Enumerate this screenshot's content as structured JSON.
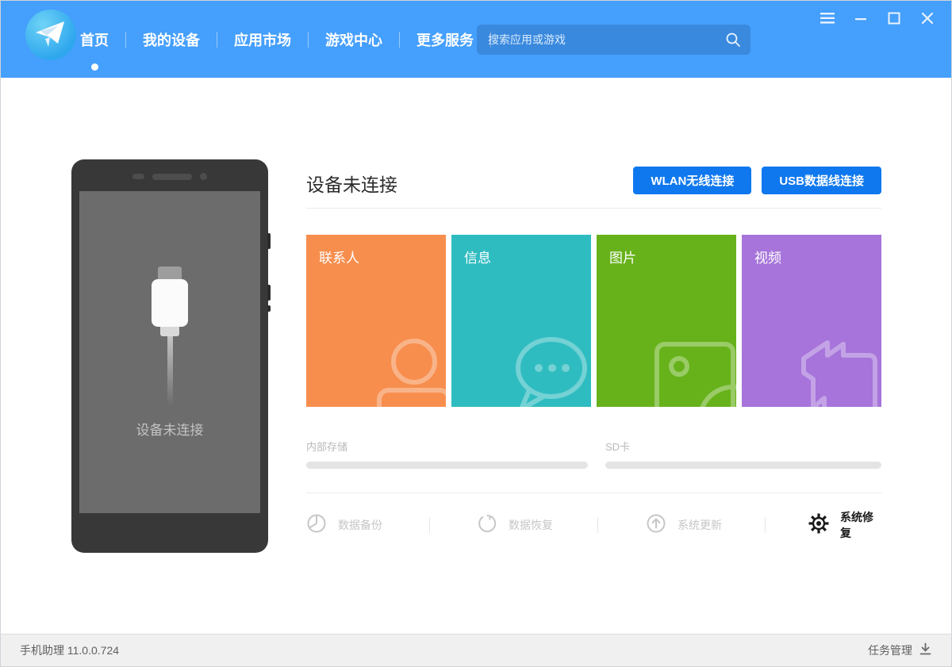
{
  "header": {
    "nav": [
      {
        "label": "首页",
        "active": true
      },
      {
        "label": "我的设备",
        "active": false
      },
      {
        "label": "应用市场",
        "active": false
      },
      {
        "label": "游戏中心",
        "active": false
      },
      {
        "label": "更多服务",
        "active": false
      }
    ],
    "search_placeholder": "搜索应用或游戏",
    "colors": {
      "header_blue": "#459ffc",
      "button_blue": "#0f78ee"
    }
  },
  "device": {
    "status_title": "设备未连接",
    "phone_overlay_text": "设备未连接",
    "connect_buttons": [
      {
        "label": "WLAN无线连接"
      },
      {
        "label": "USB数据线连接"
      }
    ]
  },
  "tiles": [
    {
      "label": "联系人",
      "color": "#f78e4e",
      "icon": "contacts-icon"
    },
    {
      "label": "信息",
      "color": "#2fbcc0",
      "icon": "messages-icon"
    },
    {
      "label": "图片",
      "color": "#67b21b",
      "icon": "pictures-icon"
    },
    {
      "label": "视频",
      "color": "#a674da",
      "icon": "videos-icon"
    }
  ],
  "storage": [
    {
      "label": "内部存储",
      "percent": 0
    },
    {
      "label": "SD卡",
      "percent": 0
    }
  ],
  "actions": [
    {
      "label": "数据备份",
      "icon": "backup-icon",
      "enabled": false
    },
    {
      "label": "数据恢复",
      "icon": "restore-icon",
      "enabled": false
    },
    {
      "label": "系统更新",
      "icon": "system-update-icon",
      "enabled": false
    },
    {
      "label": "系统修复",
      "icon": "repair-gear-icon",
      "enabled": true
    }
  ],
  "statusbar": {
    "app_version": "手机助理 11.0.0.724",
    "task_manager_label": "任务管理"
  }
}
